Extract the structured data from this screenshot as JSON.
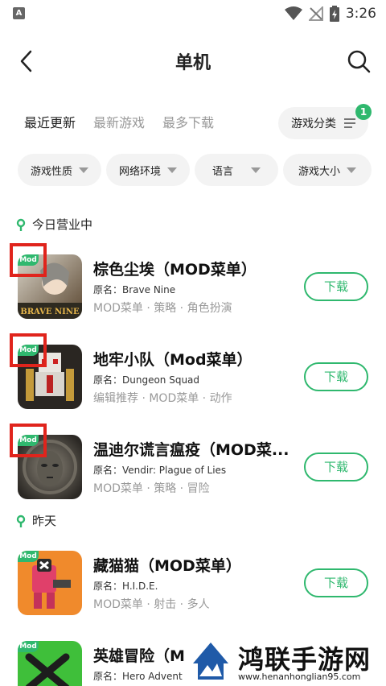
{
  "status_bar": {
    "app_indicator": "A",
    "time": "3:26"
  },
  "header": {
    "title": "单机"
  },
  "tabs": [
    {
      "label": "最近更新",
      "active": true
    },
    {
      "label": "最新游戏",
      "active": false
    },
    {
      "label": "最多下载",
      "active": false
    }
  ],
  "category": {
    "label": "游戏分类",
    "badge": "1"
  },
  "filters": [
    {
      "label": "游戏性质"
    },
    {
      "label": "网络环境"
    },
    {
      "label": "语言"
    },
    {
      "label": "游戏大小"
    }
  ],
  "sections": [
    {
      "title": "今日营业中"
    },
    {
      "title": "昨天"
    }
  ],
  "games": [
    {
      "name": "棕色尘埃（MOD菜单）",
      "original": "原名：Brave Nine",
      "tags": "MOD菜单 · 策略 · 角色扮演",
      "button": "下载",
      "mod_tag": "Mod"
    },
    {
      "name": "地牢小队（Mod菜单）",
      "original": "原名：Dungeon Squad",
      "tags": "编辑推荐 · MOD菜单 · 动作",
      "button": "下载",
      "mod_tag": "Mod"
    },
    {
      "name": "温迪尔谎言瘟疫（MOD菜...",
      "original": "原名：Vendir: Plague of Lies",
      "tags": "MOD菜单 · 策略 · 冒险",
      "button": "下载",
      "mod_tag": "Mod"
    },
    {
      "name": "藏猫猫（MOD菜单）",
      "original": "原名：H.I.D.E.",
      "tags": "MOD菜单 · 射击 · 多人",
      "button": "下载",
      "mod_tag": "Mod"
    },
    {
      "name": "英雄冒险（M",
      "original": "原名：Hero Advent",
      "tags": "",
      "button": "",
      "mod_tag": "Mod"
    }
  ],
  "watermark": {
    "title": "鸿联手游网",
    "url": "www.henanhonglian95.com"
  },
  "colors": {
    "accent": "#2fb86e",
    "highlight_box": "#e0241c"
  }
}
